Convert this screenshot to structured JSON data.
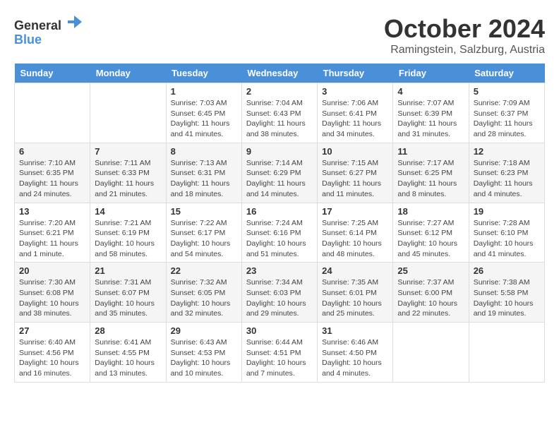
{
  "header": {
    "logo_general": "General",
    "logo_blue": "Blue",
    "month_title": "October 2024",
    "location": "Ramingstein, Salzburg, Austria"
  },
  "calendar": {
    "days_of_week": [
      "Sunday",
      "Monday",
      "Tuesday",
      "Wednesday",
      "Thursday",
      "Friday",
      "Saturday"
    ],
    "weeks": [
      [
        {
          "day": "",
          "info": ""
        },
        {
          "day": "",
          "info": ""
        },
        {
          "day": "1",
          "info": "Sunrise: 7:03 AM\nSunset: 6:45 PM\nDaylight: 11 hours and 41 minutes."
        },
        {
          "day": "2",
          "info": "Sunrise: 7:04 AM\nSunset: 6:43 PM\nDaylight: 11 hours and 38 minutes."
        },
        {
          "day": "3",
          "info": "Sunrise: 7:06 AM\nSunset: 6:41 PM\nDaylight: 11 hours and 34 minutes."
        },
        {
          "day": "4",
          "info": "Sunrise: 7:07 AM\nSunset: 6:39 PM\nDaylight: 11 hours and 31 minutes."
        },
        {
          "day": "5",
          "info": "Sunrise: 7:09 AM\nSunset: 6:37 PM\nDaylight: 11 hours and 28 minutes."
        }
      ],
      [
        {
          "day": "6",
          "info": "Sunrise: 7:10 AM\nSunset: 6:35 PM\nDaylight: 11 hours and 24 minutes."
        },
        {
          "day": "7",
          "info": "Sunrise: 7:11 AM\nSunset: 6:33 PM\nDaylight: 11 hours and 21 minutes."
        },
        {
          "day": "8",
          "info": "Sunrise: 7:13 AM\nSunset: 6:31 PM\nDaylight: 11 hours and 18 minutes."
        },
        {
          "day": "9",
          "info": "Sunrise: 7:14 AM\nSunset: 6:29 PM\nDaylight: 11 hours and 14 minutes."
        },
        {
          "day": "10",
          "info": "Sunrise: 7:15 AM\nSunset: 6:27 PM\nDaylight: 11 hours and 11 minutes."
        },
        {
          "day": "11",
          "info": "Sunrise: 7:17 AM\nSunset: 6:25 PM\nDaylight: 11 hours and 8 minutes."
        },
        {
          "day": "12",
          "info": "Sunrise: 7:18 AM\nSunset: 6:23 PM\nDaylight: 11 hours and 4 minutes."
        }
      ],
      [
        {
          "day": "13",
          "info": "Sunrise: 7:20 AM\nSunset: 6:21 PM\nDaylight: 11 hours and 1 minute."
        },
        {
          "day": "14",
          "info": "Sunrise: 7:21 AM\nSunset: 6:19 PM\nDaylight: 10 hours and 58 minutes."
        },
        {
          "day": "15",
          "info": "Sunrise: 7:22 AM\nSunset: 6:17 PM\nDaylight: 10 hours and 54 minutes."
        },
        {
          "day": "16",
          "info": "Sunrise: 7:24 AM\nSunset: 6:16 PM\nDaylight: 10 hours and 51 minutes."
        },
        {
          "day": "17",
          "info": "Sunrise: 7:25 AM\nSunset: 6:14 PM\nDaylight: 10 hours and 48 minutes."
        },
        {
          "day": "18",
          "info": "Sunrise: 7:27 AM\nSunset: 6:12 PM\nDaylight: 10 hours and 45 minutes."
        },
        {
          "day": "19",
          "info": "Sunrise: 7:28 AM\nSunset: 6:10 PM\nDaylight: 10 hours and 41 minutes."
        }
      ],
      [
        {
          "day": "20",
          "info": "Sunrise: 7:30 AM\nSunset: 6:08 PM\nDaylight: 10 hours and 38 minutes."
        },
        {
          "day": "21",
          "info": "Sunrise: 7:31 AM\nSunset: 6:07 PM\nDaylight: 10 hours and 35 minutes."
        },
        {
          "day": "22",
          "info": "Sunrise: 7:32 AM\nSunset: 6:05 PM\nDaylight: 10 hours and 32 minutes."
        },
        {
          "day": "23",
          "info": "Sunrise: 7:34 AM\nSunset: 6:03 PM\nDaylight: 10 hours and 29 minutes."
        },
        {
          "day": "24",
          "info": "Sunrise: 7:35 AM\nSunset: 6:01 PM\nDaylight: 10 hours and 25 minutes."
        },
        {
          "day": "25",
          "info": "Sunrise: 7:37 AM\nSunset: 6:00 PM\nDaylight: 10 hours and 22 minutes."
        },
        {
          "day": "26",
          "info": "Sunrise: 7:38 AM\nSunset: 5:58 PM\nDaylight: 10 hours and 19 minutes."
        }
      ],
      [
        {
          "day": "27",
          "info": "Sunrise: 6:40 AM\nSunset: 4:56 PM\nDaylight: 10 hours and 16 minutes."
        },
        {
          "day": "28",
          "info": "Sunrise: 6:41 AM\nSunset: 4:55 PM\nDaylight: 10 hours and 13 minutes."
        },
        {
          "day": "29",
          "info": "Sunrise: 6:43 AM\nSunset: 4:53 PM\nDaylight: 10 hours and 10 minutes."
        },
        {
          "day": "30",
          "info": "Sunrise: 6:44 AM\nSunset: 4:51 PM\nDaylight: 10 hours and 7 minutes."
        },
        {
          "day": "31",
          "info": "Sunrise: 6:46 AM\nSunset: 4:50 PM\nDaylight: 10 hours and 4 minutes."
        },
        {
          "day": "",
          "info": ""
        },
        {
          "day": "",
          "info": ""
        }
      ]
    ]
  }
}
